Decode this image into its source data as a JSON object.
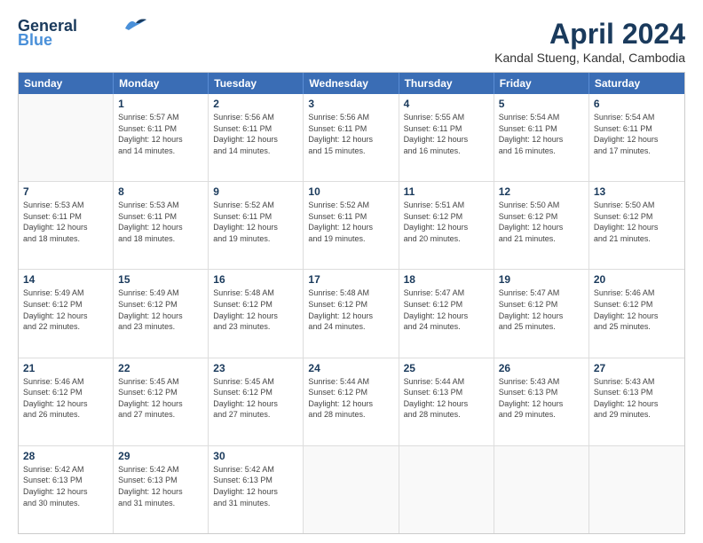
{
  "logo": {
    "line1": "General",
    "line2": "Blue"
  },
  "title": "April 2024",
  "subtitle": "Kandal Stueng, Kandal, Cambodia",
  "weekdays": [
    "Sunday",
    "Monday",
    "Tuesday",
    "Wednesday",
    "Thursday",
    "Friday",
    "Saturday"
  ],
  "rows": [
    [
      {
        "day": "",
        "info": ""
      },
      {
        "day": "1",
        "info": "Sunrise: 5:57 AM\nSunset: 6:11 PM\nDaylight: 12 hours\nand 14 minutes."
      },
      {
        "day": "2",
        "info": "Sunrise: 5:56 AM\nSunset: 6:11 PM\nDaylight: 12 hours\nand 14 minutes."
      },
      {
        "day": "3",
        "info": "Sunrise: 5:56 AM\nSunset: 6:11 PM\nDaylight: 12 hours\nand 15 minutes."
      },
      {
        "day": "4",
        "info": "Sunrise: 5:55 AM\nSunset: 6:11 PM\nDaylight: 12 hours\nand 16 minutes."
      },
      {
        "day": "5",
        "info": "Sunrise: 5:54 AM\nSunset: 6:11 PM\nDaylight: 12 hours\nand 16 minutes."
      },
      {
        "day": "6",
        "info": "Sunrise: 5:54 AM\nSunset: 6:11 PM\nDaylight: 12 hours\nand 17 minutes."
      }
    ],
    [
      {
        "day": "7",
        "info": "Sunrise: 5:53 AM\nSunset: 6:11 PM\nDaylight: 12 hours\nand 18 minutes."
      },
      {
        "day": "8",
        "info": "Sunrise: 5:53 AM\nSunset: 6:11 PM\nDaylight: 12 hours\nand 18 minutes."
      },
      {
        "day": "9",
        "info": "Sunrise: 5:52 AM\nSunset: 6:11 PM\nDaylight: 12 hours\nand 19 minutes."
      },
      {
        "day": "10",
        "info": "Sunrise: 5:52 AM\nSunset: 6:11 PM\nDaylight: 12 hours\nand 19 minutes."
      },
      {
        "day": "11",
        "info": "Sunrise: 5:51 AM\nSunset: 6:12 PM\nDaylight: 12 hours\nand 20 minutes."
      },
      {
        "day": "12",
        "info": "Sunrise: 5:50 AM\nSunset: 6:12 PM\nDaylight: 12 hours\nand 21 minutes."
      },
      {
        "day": "13",
        "info": "Sunrise: 5:50 AM\nSunset: 6:12 PM\nDaylight: 12 hours\nand 21 minutes."
      }
    ],
    [
      {
        "day": "14",
        "info": "Sunrise: 5:49 AM\nSunset: 6:12 PM\nDaylight: 12 hours\nand 22 minutes."
      },
      {
        "day": "15",
        "info": "Sunrise: 5:49 AM\nSunset: 6:12 PM\nDaylight: 12 hours\nand 23 minutes."
      },
      {
        "day": "16",
        "info": "Sunrise: 5:48 AM\nSunset: 6:12 PM\nDaylight: 12 hours\nand 23 minutes."
      },
      {
        "day": "17",
        "info": "Sunrise: 5:48 AM\nSunset: 6:12 PM\nDaylight: 12 hours\nand 24 minutes."
      },
      {
        "day": "18",
        "info": "Sunrise: 5:47 AM\nSunset: 6:12 PM\nDaylight: 12 hours\nand 24 minutes."
      },
      {
        "day": "19",
        "info": "Sunrise: 5:47 AM\nSunset: 6:12 PM\nDaylight: 12 hours\nand 25 minutes."
      },
      {
        "day": "20",
        "info": "Sunrise: 5:46 AM\nSunset: 6:12 PM\nDaylight: 12 hours\nand 25 minutes."
      }
    ],
    [
      {
        "day": "21",
        "info": "Sunrise: 5:46 AM\nSunset: 6:12 PM\nDaylight: 12 hours\nand 26 minutes."
      },
      {
        "day": "22",
        "info": "Sunrise: 5:45 AM\nSunset: 6:12 PM\nDaylight: 12 hours\nand 27 minutes."
      },
      {
        "day": "23",
        "info": "Sunrise: 5:45 AM\nSunset: 6:12 PM\nDaylight: 12 hours\nand 27 minutes."
      },
      {
        "day": "24",
        "info": "Sunrise: 5:44 AM\nSunset: 6:12 PM\nDaylight: 12 hours\nand 28 minutes."
      },
      {
        "day": "25",
        "info": "Sunrise: 5:44 AM\nSunset: 6:13 PM\nDaylight: 12 hours\nand 28 minutes."
      },
      {
        "day": "26",
        "info": "Sunrise: 5:43 AM\nSunset: 6:13 PM\nDaylight: 12 hours\nand 29 minutes."
      },
      {
        "day": "27",
        "info": "Sunrise: 5:43 AM\nSunset: 6:13 PM\nDaylight: 12 hours\nand 29 minutes."
      }
    ],
    [
      {
        "day": "28",
        "info": "Sunrise: 5:42 AM\nSunset: 6:13 PM\nDaylight: 12 hours\nand 30 minutes."
      },
      {
        "day": "29",
        "info": "Sunrise: 5:42 AM\nSunset: 6:13 PM\nDaylight: 12 hours\nand 31 minutes."
      },
      {
        "day": "30",
        "info": "Sunrise: 5:42 AM\nSunset: 6:13 PM\nDaylight: 12 hours\nand 31 minutes."
      },
      {
        "day": "",
        "info": ""
      },
      {
        "day": "",
        "info": ""
      },
      {
        "day": "",
        "info": ""
      },
      {
        "day": "",
        "info": ""
      }
    ]
  ]
}
